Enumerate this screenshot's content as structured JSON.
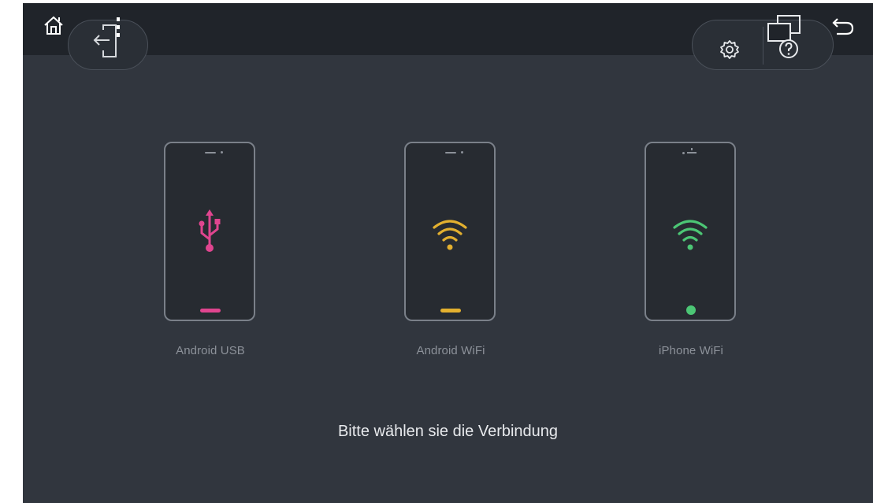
{
  "colors": {
    "android_usb": "#e0458f",
    "android_wifi": "#e3b02f",
    "iphone_wifi": "#4cc675",
    "background": "#31363e",
    "topbar": "#20242a"
  },
  "topbar": {
    "left_icons": [
      "home-icon",
      "exit-icon"
    ],
    "right_icons": [
      "settings-icon",
      "help-icon",
      "back-icon"
    ]
  },
  "devices": [
    {
      "label": "Android USB",
      "icon": "usb-icon"
    },
    {
      "label": "Android WiFi",
      "icon": "wifi-icon"
    },
    {
      "label": "iPhone WiFi",
      "icon": "wifi-icon"
    }
  ],
  "prompt": "Bitte wählen sie die Verbindung"
}
